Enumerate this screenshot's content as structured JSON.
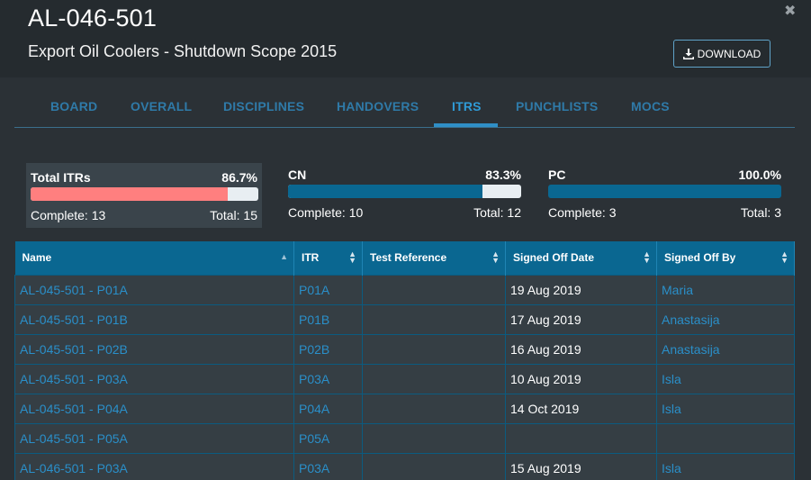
{
  "header": {
    "asset_id": "AL-046-501",
    "subtitle": "Export Oil Coolers - Shutdown Scope 2015",
    "close_glyph": "✖",
    "download_label": "DOWNLOAD",
    "download_icon": "download-icon"
  },
  "tabs": [
    {
      "label": "BOARD",
      "active": false
    },
    {
      "label": "OVERALL",
      "active": false
    },
    {
      "label": "DISCIPLINES",
      "active": false
    },
    {
      "label": "HANDOVERS",
      "active": false
    },
    {
      "label": "ITRS",
      "active": true
    },
    {
      "label": "PUNCHLISTS",
      "active": false
    },
    {
      "label": "MOCS",
      "active": false
    }
  ],
  "stats": [
    {
      "title": "Total ITRs",
      "pct": "86.7%",
      "progress": 0.867,
      "complete": "Complete: 13",
      "total": "Total: 15",
      "color": "#ff7f7f"
    },
    {
      "title": "CN",
      "pct": "83.3%",
      "progress": 0.833,
      "complete": "Complete: 10",
      "total": "Total: 12",
      "color": "#0a6791"
    },
    {
      "title": "PC",
      "pct": "100.0%",
      "progress": 1.0,
      "complete": "Complete: 3",
      "total": "Total: 3",
      "color": "#0a6791"
    }
  ],
  "table": {
    "columns": [
      "Name",
      "ITR",
      "Test Reference",
      "Signed Off Date",
      "Signed Off By"
    ],
    "rows": [
      [
        "AL-045-501 - P01A",
        "P01A",
        "",
        "19 Aug 2019",
        "Maria"
      ],
      [
        "AL-045-501 - P01B",
        "P01B",
        "",
        "17 Aug 2019",
        "Anastasija"
      ],
      [
        "AL-045-501 - P02B",
        "P02B",
        "",
        "16 Aug 2019",
        "Anastasija"
      ],
      [
        "AL-045-501 - P03A",
        "P03A",
        "",
        "10 Aug 2019",
        "Isla"
      ],
      [
        "AL-045-501 - P04A",
        "P04A",
        "",
        "14 Oct 2019",
        "Isla"
      ],
      [
        "AL-045-501 - P05A",
        "P05A",
        "",
        "",
        ""
      ],
      [
        "AL-046-501 - P03A",
        "P03A",
        "",
        "15 Aug 2019",
        "Isla"
      ]
    ]
  },
  "colors": {
    "accent": "#2f8fc7",
    "header_bg": "#0a6791",
    "link": "#2a8fc9",
    "alert_fill": "#ff7f7f"
  }
}
